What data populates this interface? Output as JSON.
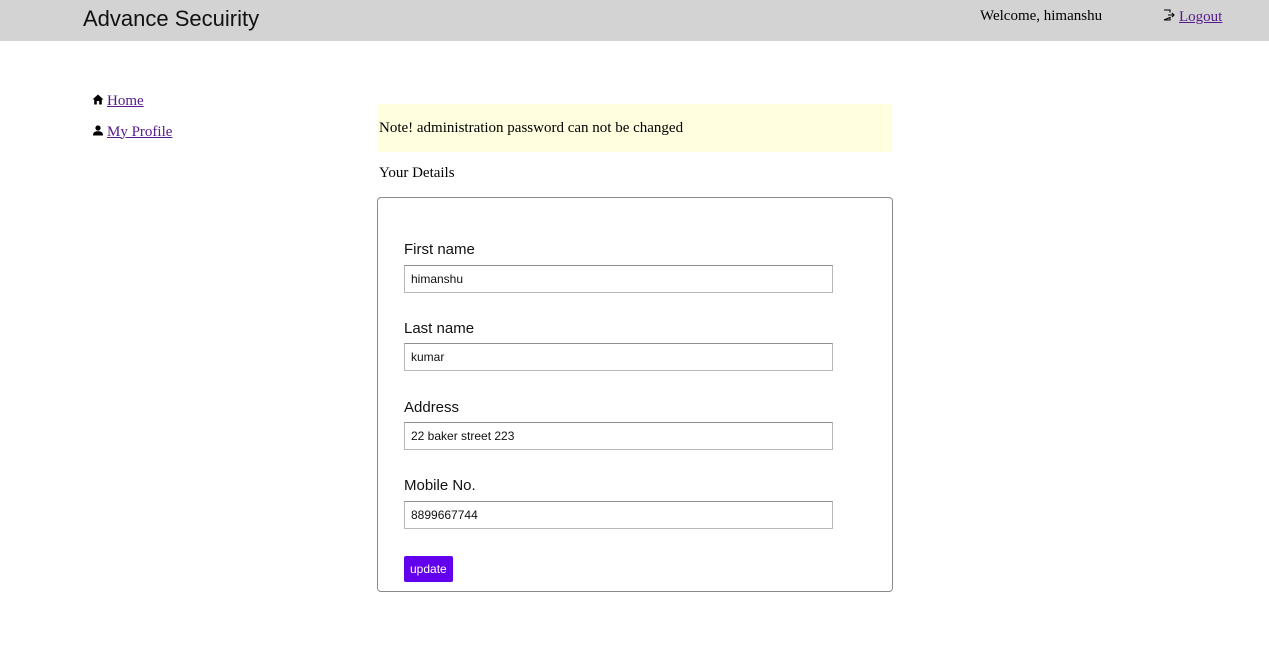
{
  "header": {
    "brand": "Advance Secuirity",
    "welcome": "Welcome, himanshu",
    "logout_label": "Logout"
  },
  "sidebar": {
    "items": [
      {
        "label": "Home",
        "icon": "home-icon"
      },
      {
        "label": "My Profile",
        "icon": "user-icon"
      }
    ]
  },
  "main": {
    "note": "Note! administration password can not be changed",
    "details_title": "Your Details",
    "form": {
      "first_name_label": "First name",
      "first_name_value": "himanshu",
      "last_name_label": "Last name",
      "last_name_value": "kumar",
      "address_label": "Address",
      "address_value": "22 baker street 223",
      "mobile_label": "Mobile No.",
      "mobile_value": "8899667744",
      "update_label": "update"
    }
  },
  "colors": {
    "header_bg": "#d3d3d3",
    "note_bg": "#ffffe0",
    "link": "#551a8b",
    "button": "#6200ee"
  }
}
